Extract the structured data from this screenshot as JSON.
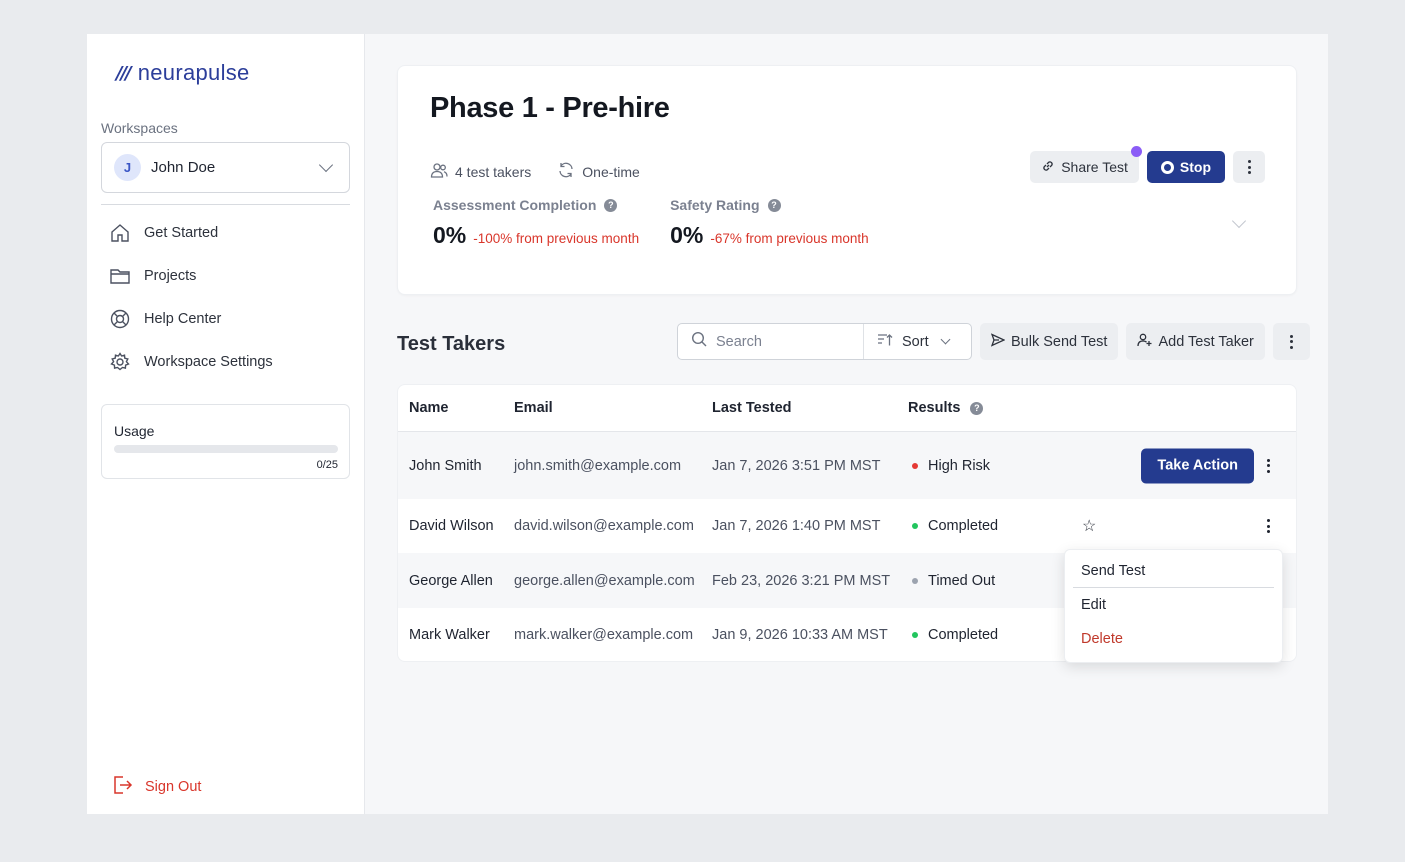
{
  "brand": {
    "mark": "///",
    "name": "neurapulse"
  },
  "sidebar": {
    "workspaces_label": "Workspaces",
    "workspace": {
      "avatar_initial": "J",
      "name": "John Doe"
    },
    "nav": [
      {
        "label": "Get Started",
        "icon": "home-icon"
      },
      {
        "label": "Projects",
        "icon": "folder-icon"
      },
      {
        "label": "Help Center",
        "icon": "lifebuoy-icon"
      },
      {
        "label": "Workspace Settings",
        "icon": "gear-icon"
      }
    ],
    "usage": {
      "label": "Usage",
      "used": 0,
      "total": 25,
      "count_text": "0/25"
    },
    "sign_out": "Sign Out"
  },
  "test": {
    "title": "Phase 1 - Pre-hire",
    "takers": "4 test takers",
    "frequency": "One-time",
    "share_label": "Share Test",
    "stop_label": "Stop",
    "stats": [
      {
        "label": "Assessment Completion",
        "value": "0%",
        "delta": "-100% from previous month"
      },
      {
        "label": "Safety Rating",
        "value": "0%",
        "delta": "-67% from previous month"
      }
    ]
  },
  "takers_section": {
    "title": "Test Takers",
    "search_placeholder": "Search",
    "sort_label": "Sort",
    "bulk_send_label": "Bulk Send Test",
    "add_taker_label": "Add Test Taker",
    "columns": {
      "name": "Name",
      "email": "Email",
      "last_tested": "Last Tested",
      "results": "Results"
    },
    "rows": [
      {
        "name": "John Smith",
        "email": "john.smith@example.com",
        "last_tested": "Jan 7, 2026 3:51 PM MST",
        "result": "High Risk",
        "status_color": "#e53935",
        "action": "Take Action"
      },
      {
        "name": "David Wilson",
        "email": "david.wilson@example.com",
        "last_tested": "Jan 7, 2026 1:40 PM MST",
        "result": "Completed",
        "status_color": "#22c55e"
      },
      {
        "name": "George Allen",
        "email": "george.allen@example.com",
        "last_tested": "Feb 23, 2026 3:21 PM MST",
        "result": "Timed Out",
        "status_color": "#9ca3af"
      },
      {
        "name": "Mark Walker",
        "email": "mark.walker@example.com",
        "last_tested": "Jan 9, 2026 10:33 AM MST",
        "result": "Completed",
        "status_color": "#22c55e"
      }
    ]
  },
  "context_menu": {
    "items": [
      {
        "label": "Send Test"
      },
      {
        "label": "Edit"
      },
      {
        "label": "Delete"
      }
    ]
  },
  "colors": {
    "primary": "#243b8f",
    "danger": "#d9362b",
    "accent_dot": "#8b5cf6"
  }
}
